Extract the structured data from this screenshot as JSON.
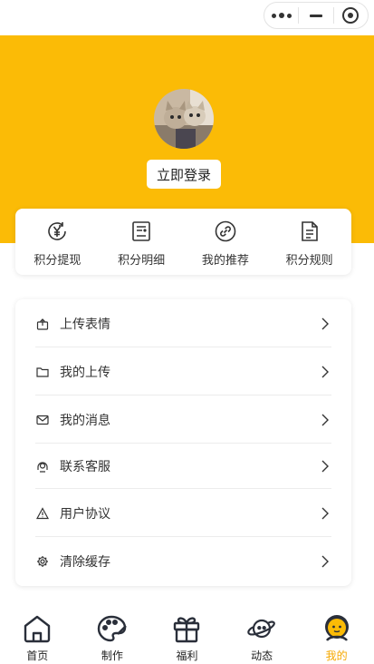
{
  "header": {
    "login_label": "立即登录"
  },
  "points": [
    {
      "label": "积分提现",
      "icon": "yuan-refresh-icon"
    },
    {
      "label": "积分明细",
      "icon": "list-detail-icon"
    },
    {
      "label": "我的推荐",
      "icon": "link-icon"
    },
    {
      "label": "积分规则",
      "icon": "document-icon"
    }
  ],
  "menu": [
    {
      "label": "上传表情",
      "icon": "upload-emoji-icon"
    },
    {
      "label": "我的上传",
      "icon": "folder-icon"
    },
    {
      "label": "我的消息",
      "icon": "mail-icon"
    },
    {
      "label": "联系客服",
      "icon": "headset-icon"
    },
    {
      "label": "用户协议",
      "icon": "warning-icon"
    },
    {
      "label": "清除缓存",
      "icon": "gear-icon"
    }
  ],
  "tabs": [
    {
      "label": "首页",
      "icon": "home-icon",
      "active": false
    },
    {
      "label": "制作",
      "icon": "palette-icon",
      "active": false
    },
    {
      "label": "福利",
      "icon": "gift-icon",
      "active": false
    },
    {
      "label": "动态",
      "icon": "planet-icon",
      "active": false
    },
    {
      "label": "我的",
      "icon": "profile-face-icon",
      "active": true
    }
  ],
  "colors": {
    "brand_yellow": "#fbbb06",
    "active_tab": "#f5a800",
    "text": "#333333"
  }
}
